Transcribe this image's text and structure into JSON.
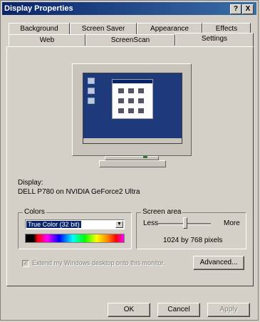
{
  "window": {
    "title": "Display Properties"
  },
  "titlebar": {
    "help_label": "?",
    "close_label": "X"
  },
  "tabs": {
    "row1": [
      "Background",
      "Screen Saver",
      "Appearance",
      "Effects"
    ],
    "row2": [
      "Web",
      "ScreenScan",
      "Settings"
    ],
    "active": "Settings"
  },
  "display": {
    "label": "Display:",
    "device": "DELL P780 on NVIDIA GeForce2 Ultra"
  },
  "colors": {
    "legend": "Colors",
    "selected": "True Color (32 bit)",
    "dropdown_arrow": "▼"
  },
  "screen_area": {
    "legend": "Screen area",
    "less_label": "Less",
    "more_label": "More",
    "resolution": "1024 by 768 pixels",
    "slider_level": 0.5
  },
  "extend": {
    "label": "Extend my Windows desktop onto this monitor.",
    "checked": true,
    "check_glyph": "✓"
  },
  "buttons": {
    "advanced": "Advanced...",
    "ok": "OK",
    "cancel": "Cancel",
    "apply": "Apply"
  },
  "icons": {
    "monitor": "monitor-preview-icon",
    "dropdown": "chevron-down-icon"
  }
}
